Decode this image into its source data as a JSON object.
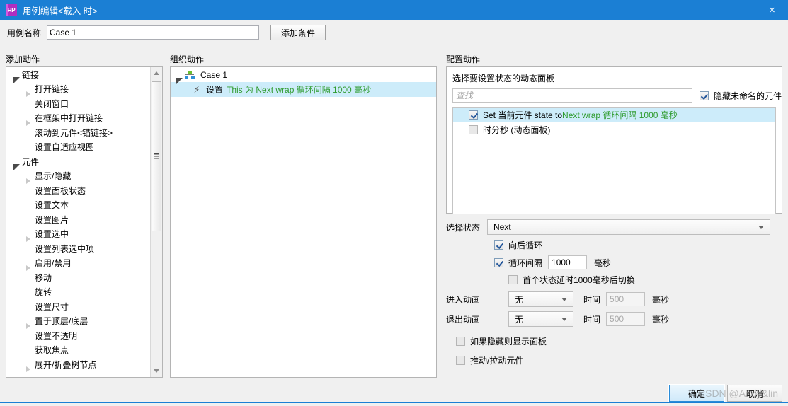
{
  "window": {
    "title": "用例编辑<载入 时>",
    "logo_text": "RP",
    "close_icon": "×"
  },
  "case_name": {
    "label": "用例名称",
    "value": "Case 1",
    "add_condition_button": "添加条件"
  },
  "columns": {
    "add_action": "添加动作",
    "organize_action": "组织动作",
    "configure_action": "配置动作"
  },
  "action_tree": [
    {
      "label": "链接",
      "level": 0,
      "twisty": "expanded"
    },
    {
      "label": "打开链接",
      "level": 1,
      "twisty": "collapsed"
    },
    {
      "label": "关闭窗口",
      "level": 1,
      "twisty": "none"
    },
    {
      "label": "在框架中打开链接",
      "level": 1,
      "twisty": "collapsed"
    },
    {
      "label": "滚动到元件<锚链接>",
      "level": 1,
      "twisty": "none"
    },
    {
      "label": "设置自适应视图",
      "level": 1,
      "twisty": "none"
    },
    {
      "label": "元件",
      "level": 0,
      "twisty": "expanded"
    },
    {
      "label": "显示/隐藏",
      "level": 1,
      "twisty": "collapsed"
    },
    {
      "label": "设置面板状态",
      "level": 1,
      "twisty": "none"
    },
    {
      "label": "设置文本",
      "level": 1,
      "twisty": "none"
    },
    {
      "label": "设置图片",
      "level": 1,
      "twisty": "none"
    },
    {
      "label": "设置选中",
      "level": 1,
      "twisty": "collapsed"
    },
    {
      "label": "设置列表选中项",
      "level": 1,
      "twisty": "none"
    },
    {
      "label": "启用/禁用",
      "level": 1,
      "twisty": "collapsed"
    },
    {
      "label": "移动",
      "level": 1,
      "twisty": "none"
    },
    {
      "label": "旋转",
      "level": 1,
      "twisty": "none"
    },
    {
      "label": "设置尺寸",
      "level": 1,
      "twisty": "none"
    },
    {
      "label": "置于顶层/底层",
      "level": 1,
      "twisty": "collapsed"
    },
    {
      "label": "设置不透明",
      "level": 1,
      "twisty": "none"
    },
    {
      "label": "获取焦点",
      "level": 1,
      "twisty": "none"
    },
    {
      "label": "展开/折叠树节点",
      "level": 1,
      "twisty": "collapsed"
    }
  ],
  "organize": {
    "case_node": "Case 1",
    "action_prefix": "设置",
    "action_detail": "This 为 Next wrap 循环间隔 1000 毫秒"
  },
  "configure": {
    "widget_box_title": "选择要设置状态的动态面板",
    "search_placeholder": "查找",
    "search_value": "",
    "hide_unnamed_label": "隐藏未命名的元件",
    "hide_unnamed_checked": true,
    "widgets": [
      {
        "label_plain": "Set 当前元件 state to ",
        "label_green": "Next wrap 循环间隔 1000 毫秒",
        "checked": true,
        "selected": true
      },
      {
        "label_plain": "时分秒 (动态面板)",
        "label_green": "",
        "checked": false,
        "selected": false
      }
    ],
    "state_label": "选择状态",
    "state_value": "Next",
    "wrap_label": "向后循环",
    "wrap_checked": true,
    "repeat_label": "循环间隔",
    "repeat_checked": true,
    "repeat_value": "1000",
    "repeat_unit": "毫秒",
    "first_delay_label": "首个状态延时1000毫秒后切换",
    "first_delay_checked": false,
    "enter_anim_label": "进入动画",
    "enter_anim_value": "无",
    "enter_time_label": "时间",
    "enter_time_value": "500",
    "enter_time_unit": "毫秒",
    "exit_anim_label": "退出动画",
    "exit_anim_value": "无",
    "exit_time_label": "时间",
    "exit_time_value": "500",
    "exit_time_unit": "毫秒",
    "show_if_hidden_label": "如果隐藏则显示面板",
    "show_if_hidden_checked": false,
    "push_pull_label": "推动/拉动元件",
    "push_pull_checked": false
  },
  "footer": {
    "ok": "确定",
    "cancel": "取消",
    "watermark": "CSDN @Andy&lin"
  }
}
